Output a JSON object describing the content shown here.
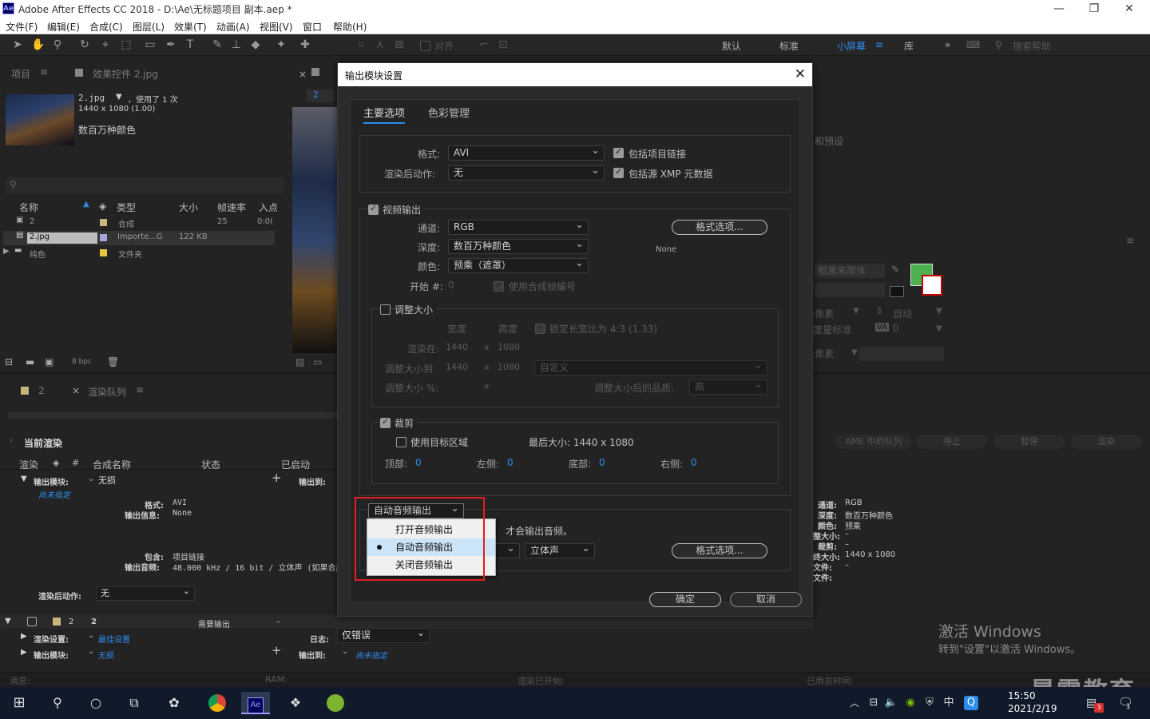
{
  "window": {
    "app_icon": "Ae",
    "title": "Adobe After Effects CC 2018 - D:\\Ae\\无标题项目 副本.aep *"
  },
  "menu": [
    "文件(F)",
    "编辑(E)",
    "合成(C)",
    "图层(L)",
    "效果(T)",
    "动画(A)",
    "视图(V)",
    "窗口",
    "帮助(H)"
  ],
  "toolbar": {
    "align_label": "对齐",
    "workspaces": [
      "默认",
      "标准",
      "小屏幕",
      "库"
    ],
    "active_workspace": "小屏幕",
    "search_placeholder": "搜索帮助"
  },
  "project_panel": {
    "tab": "项目",
    "effects_tab": "效果控件 2.jpg",
    "file_name": "2.jpg",
    "used_text": "，使用了 1 次",
    "dimensions": "1440 x 1080 (1.00)",
    "color_info": "数百万种颜色",
    "columns": [
      "名称",
      "类型",
      "大小",
      "帧速率",
      "入点"
    ],
    "rows": [
      {
        "name": "2",
        "type": "合成",
        "size": "",
        "fps": "25",
        "in": "0:0("
      },
      {
        "name": "2.jpg",
        "type": "Importe...G",
        "size": "122 KB",
        "fps": "",
        "in": ""
      },
      {
        "name": "纯色",
        "type": "文件夹",
        "size": "",
        "fps": "",
        "in": ""
      }
    ],
    "bpc": "8 bpc"
  },
  "comp_panel": {
    "tab_num": "2"
  },
  "render_queue": {
    "tab_comp": "2",
    "tab": "渲染队列",
    "current_render": "当前渲染",
    "columns": [
      "渲染",
      "#",
      "合成名称",
      "状态",
      "已启动"
    ],
    "output_module_label": "输出模块:",
    "output_module_value": "无损",
    "output_to_label": "输出到:",
    "not_specified": "尚未指定",
    "format_label": "格式:",
    "format_value": "AVI",
    "output_info_label": "输出信息:",
    "output_info_value": "None",
    "include_label": "包含:",
    "include_value": "项目链接",
    "output_audio_label": "输出音频:",
    "output_audio_value": "48.000 kHz / 16 bit / 立体声 (如果合成",
    "post_render_label": "渲染后动作:",
    "post_render_value": "无",
    "item_num": "2",
    "item_name": "2",
    "item_status": "需要输出",
    "item_dash": "–",
    "render_settings_label": "渲染设置:",
    "render_settings_value": "最佳设置",
    "log_label": "日志:",
    "log_value": "仅错误",
    "output_module2_label": "输出模块:",
    "output_module2_value": "无损",
    "output_to2_label": "输出到:",
    "not_specified2": "尚未指定",
    "right_buttons": [
      "AME 中的队列",
      "停止",
      "暂停",
      "渲染"
    ],
    "right_info": [
      {
        "k": "通道:",
        "v": "RGB"
      },
      {
        "k": "深度:",
        "v": "数百万种颜色"
      },
      {
        "k": "颜色:",
        "v": "预乘"
      },
      {
        "k": "整大小:",
        "v": "–"
      },
      {
        "k": "裁剪:",
        "v": "–"
      },
      {
        "k": "终大小:",
        "v": "1440 x 1080"
      },
      {
        "k": "文件:",
        "v": "–"
      },
      {
        "k": "文件:",
        "v": ""
      }
    ]
  },
  "right_panel": {
    "presets_text": "和预设",
    "font_name": "粗黑宋简体",
    "pixels_label": "像素",
    "auto_label": "自动",
    "measure_label": "度量标准",
    "va_value": "0",
    "pixels_label2": "像素",
    "fill_color": "#4caf50"
  },
  "status_bar": {
    "message": "消息:",
    "ram": "RAM:",
    "render_started": "渲染已开始:",
    "total_time": "已用总时间:"
  },
  "dialog": {
    "title": "输出模块设置",
    "tabs": [
      "主要选项",
      "色彩管理"
    ],
    "format_label": "格式:",
    "format_value": "AVI",
    "post_render_label": "渲染后动作:",
    "post_render_value": "无",
    "include_project_link": "包括项目链接",
    "include_xmp": "包括源 XMP 元数据",
    "video_output": "视频输出",
    "channel_label": "通道:",
    "channel_value": "RGB",
    "depth_label": "深度:",
    "depth_value": "数百万种颜色",
    "color_label": "颜色:",
    "color_value": "预乘（遮罩）",
    "start_label": "开始 #:",
    "start_value": "0",
    "use_comp_frame": "使用合成帧编号",
    "format_options": "格式选项...",
    "codec_none": "None",
    "resize": "调整大小",
    "width_label": "宽度",
    "height_label": "高度",
    "lock_aspect": "锁定长宽比为 4:3 (1.33)",
    "render_at_label": "渲染在:",
    "render_at_w": "1440",
    "render_at_h": "1080",
    "resize_to_label": "调整大小到:",
    "resize_to_w": "1440",
    "resize_to_h": "1080",
    "resize_custom": "自定义",
    "resize_pct_label": "调整大小 %:",
    "x_sep": "x",
    "quality_label": "调整大小后的品质:",
    "quality_value": "高",
    "crop": "裁剪",
    "use_roi": "使用目标区域",
    "final_size": "最后大小: 1440 x 1080",
    "top_label": "顶部:",
    "top_value": "0",
    "left_label": "左侧:",
    "left_value": "0",
    "bottom_label": "底部:",
    "bottom_value": "0",
    "right_label": "右侧:",
    "right_value": "0",
    "audio_select": "自动音频输出",
    "audio_note": "才会输出音频。",
    "audio_channels": "立体声",
    "audio_format_options": "格式选项...",
    "ok": "确定",
    "cancel": "取消"
  },
  "audio_dropdown": {
    "options": [
      "打开音频输出",
      "自动音频输出",
      "关闭音频输出"
    ],
    "selected_index": 1
  },
  "watermark": {
    "line1": "激活 Windows",
    "line2": "转到\"设置\"以激活 Windows。",
    "brand": "暴需教育"
  },
  "taskbar": {
    "time": "15:50",
    "date": "2021/2/19",
    "ime": "中",
    "badge": "3",
    "notif": "1"
  }
}
